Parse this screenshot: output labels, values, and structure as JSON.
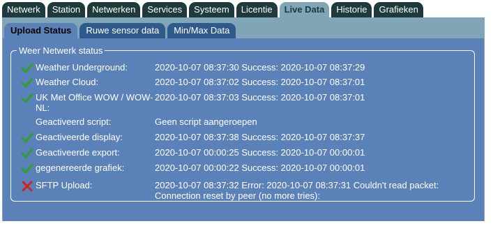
{
  "main_tabs": [
    "Netwerk",
    "Station",
    "Netwerken",
    "Services",
    "Systeem",
    "Licentie",
    "Live Data",
    "Historie",
    "Grafieken"
  ],
  "active_main_tab": "Live Data",
  "sub_tabs": [
    "Upload Status",
    "Ruwe sensor data",
    "Min/Max Data"
  ],
  "active_sub_tab": "Upload Status",
  "fieldset_title": "Weer Netwerk status",
  "rows": [
    {
      "icon": "checkmark-icon",
      "label": "Weather Underground:",
      "value": "2020-10-07 08:37:30 Success: 2020-10-07 08:37:29"
    },
    {
      "icon": "checkmark-icon",
      "label": "Weather Cloud:",
      "value": "2020-10-07 08:37:02 Success: 2020-10-07 08:37:01"
    },
    {
      "icon": "checkmark-icon",
      "label": "UK Met Office WOW / WOW-NL:",
      "value": "2020-10-07 08:37:03 Success: 2020-10-07 08:37:01"
    },
    {
      "icon": "",
      "label": "Geactiveerd script:",
      "value": "Geen script aangeroepen"
    },
    {
      "icon": "checkmark-icon",
      "label": "Geactiveerde display:",
      "value": "2020-10-07 08:37:38 Success: 2020-10-07 08:37:37"
    },
    {
      "icon": "checkmark-icon",
      "label": "Geactiveerde export:",
      "value": "2020-10-07 00:00:25 Success: 2020-10-07 00:00:01"
    },
    {
      "icon": "checkmark-icon",
      "label": "gegenereerde grafiek:",
      "value": "2020-10-07 00:00:22 Success: 2020-10-07 00:00:01"
    },
    {
      "icon": "error-x-icon",
      "label": "SFTP Upload:",
      "value": "2020-10-07 08:37:32 Error: 2020-10-07 08:37:31 Couldn't read packet: Connection reset by peer (no more tries):"
    }
  ],
  "colors": {
    "tab_dark": "#1f3a3d",
    "panel_light": "#7fa5b6",
    "content_blue": "#5b82b8",
    "subtab_blue": "#2e5a8c",
    "check_green": "#2f9e2f",
    "error_red": "#d42020"
  }
}
